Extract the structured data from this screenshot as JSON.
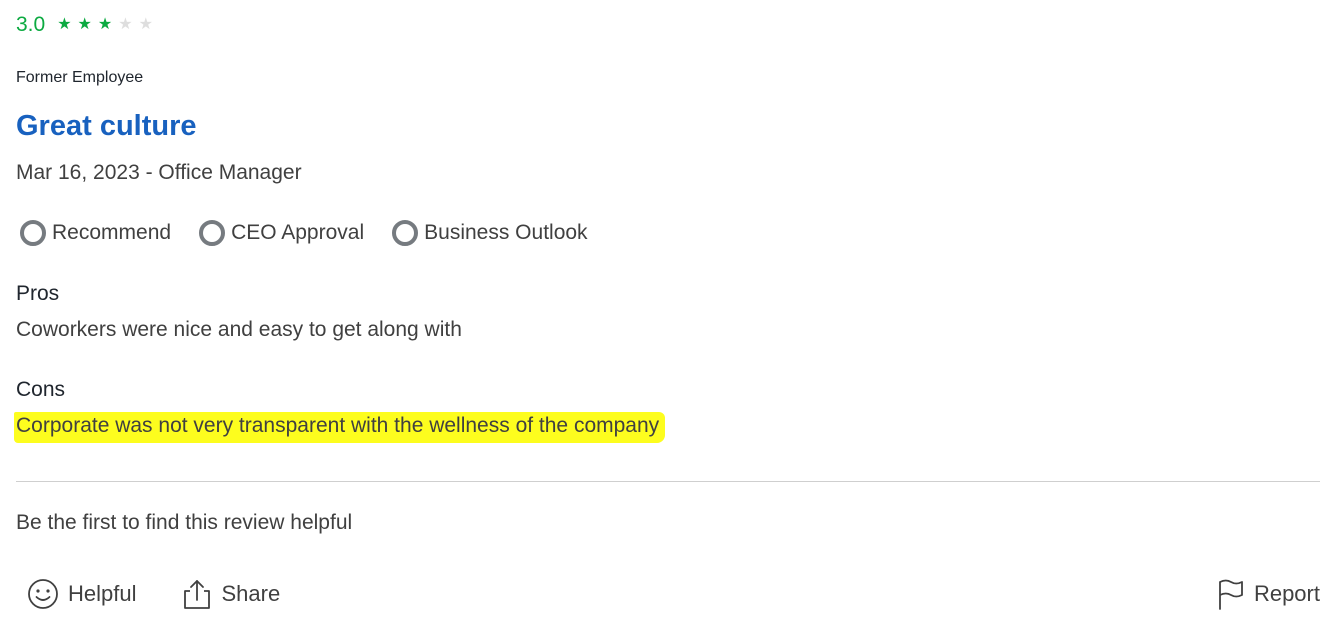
{
  "review": {
    "rating": "3.0",
    "rating_stars": 3,
    "rating_max": 5,
    "status": "Former Employee",
    "title": "Great culture",
    "meta": "Mar 16, 2023 - Office Manager",
    "indicators": [
      {
        "label": "Recommend",
        "icon": "circle-neutral-icon"
      },
      {
        "label": "CEO Approval",
        "icon": "circle-neutral-icon"
      },
      {
        "label": "Business Outlook",
        "icon": "circle-neutral-icon"
      }
    ],
    "pros_label": "Pros",
    "pros_text": "Coworkers were nice and easy to get along with",
    "cons_label": "Cons",
    "cons_text": "Corporate was not very transparent with the wellness of the company",
    "helpful_note": "Be the first to find this review helpful"
  },
  "actions": {
    "helpful_label": "Helpful",
    "share_label": "Share",
    "report_label": "Report"
  },
  "colors": {
    "rating": "#0caa41",
    "title": "#1861bf",
    "highlight": "#fdfd1e",
    "neutral_icon": "#767b80"
  }
}
